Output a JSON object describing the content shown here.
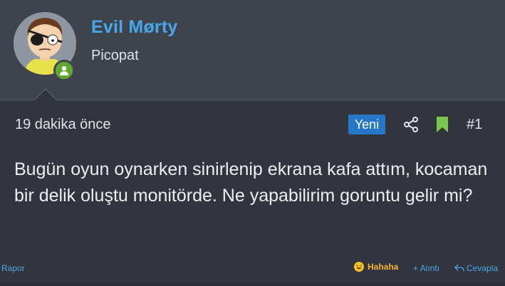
{
  "post": {
    "author": {
      "name": "Evil Mørty",
      "title": "Picopat",
      "avatar_icon": "evil-morty-avatar",
      "online_status_icon": "online-user-icon"
    },
    "time": "19 dakika önce",
    "badge": "Yeni",
    "share_icon": "share-icon",
    "bookmark_icon": "bookmark-icon",
    "number": "#1",
    "content": "Bugün oyun oynarken sinirlenip ekrana kafa attım, kocaman bir delik oluştu monitörde. Ne yapabilirim goruntu gelir mi?"
  },
  "actions": {
    "report": "Rapor",
    "reaction": "Hahaha",
    "quote": "+ Alıntı",
    "reply": "Cevapla"
  },
  "colors": {
    "accent": "#47a7eb",
    "badge_bg": "#2577c7",
    "bookmark": "#7ac74f",
    "online": "#5ea82e",
    "reaction": "#f5b52e"
  }
}
